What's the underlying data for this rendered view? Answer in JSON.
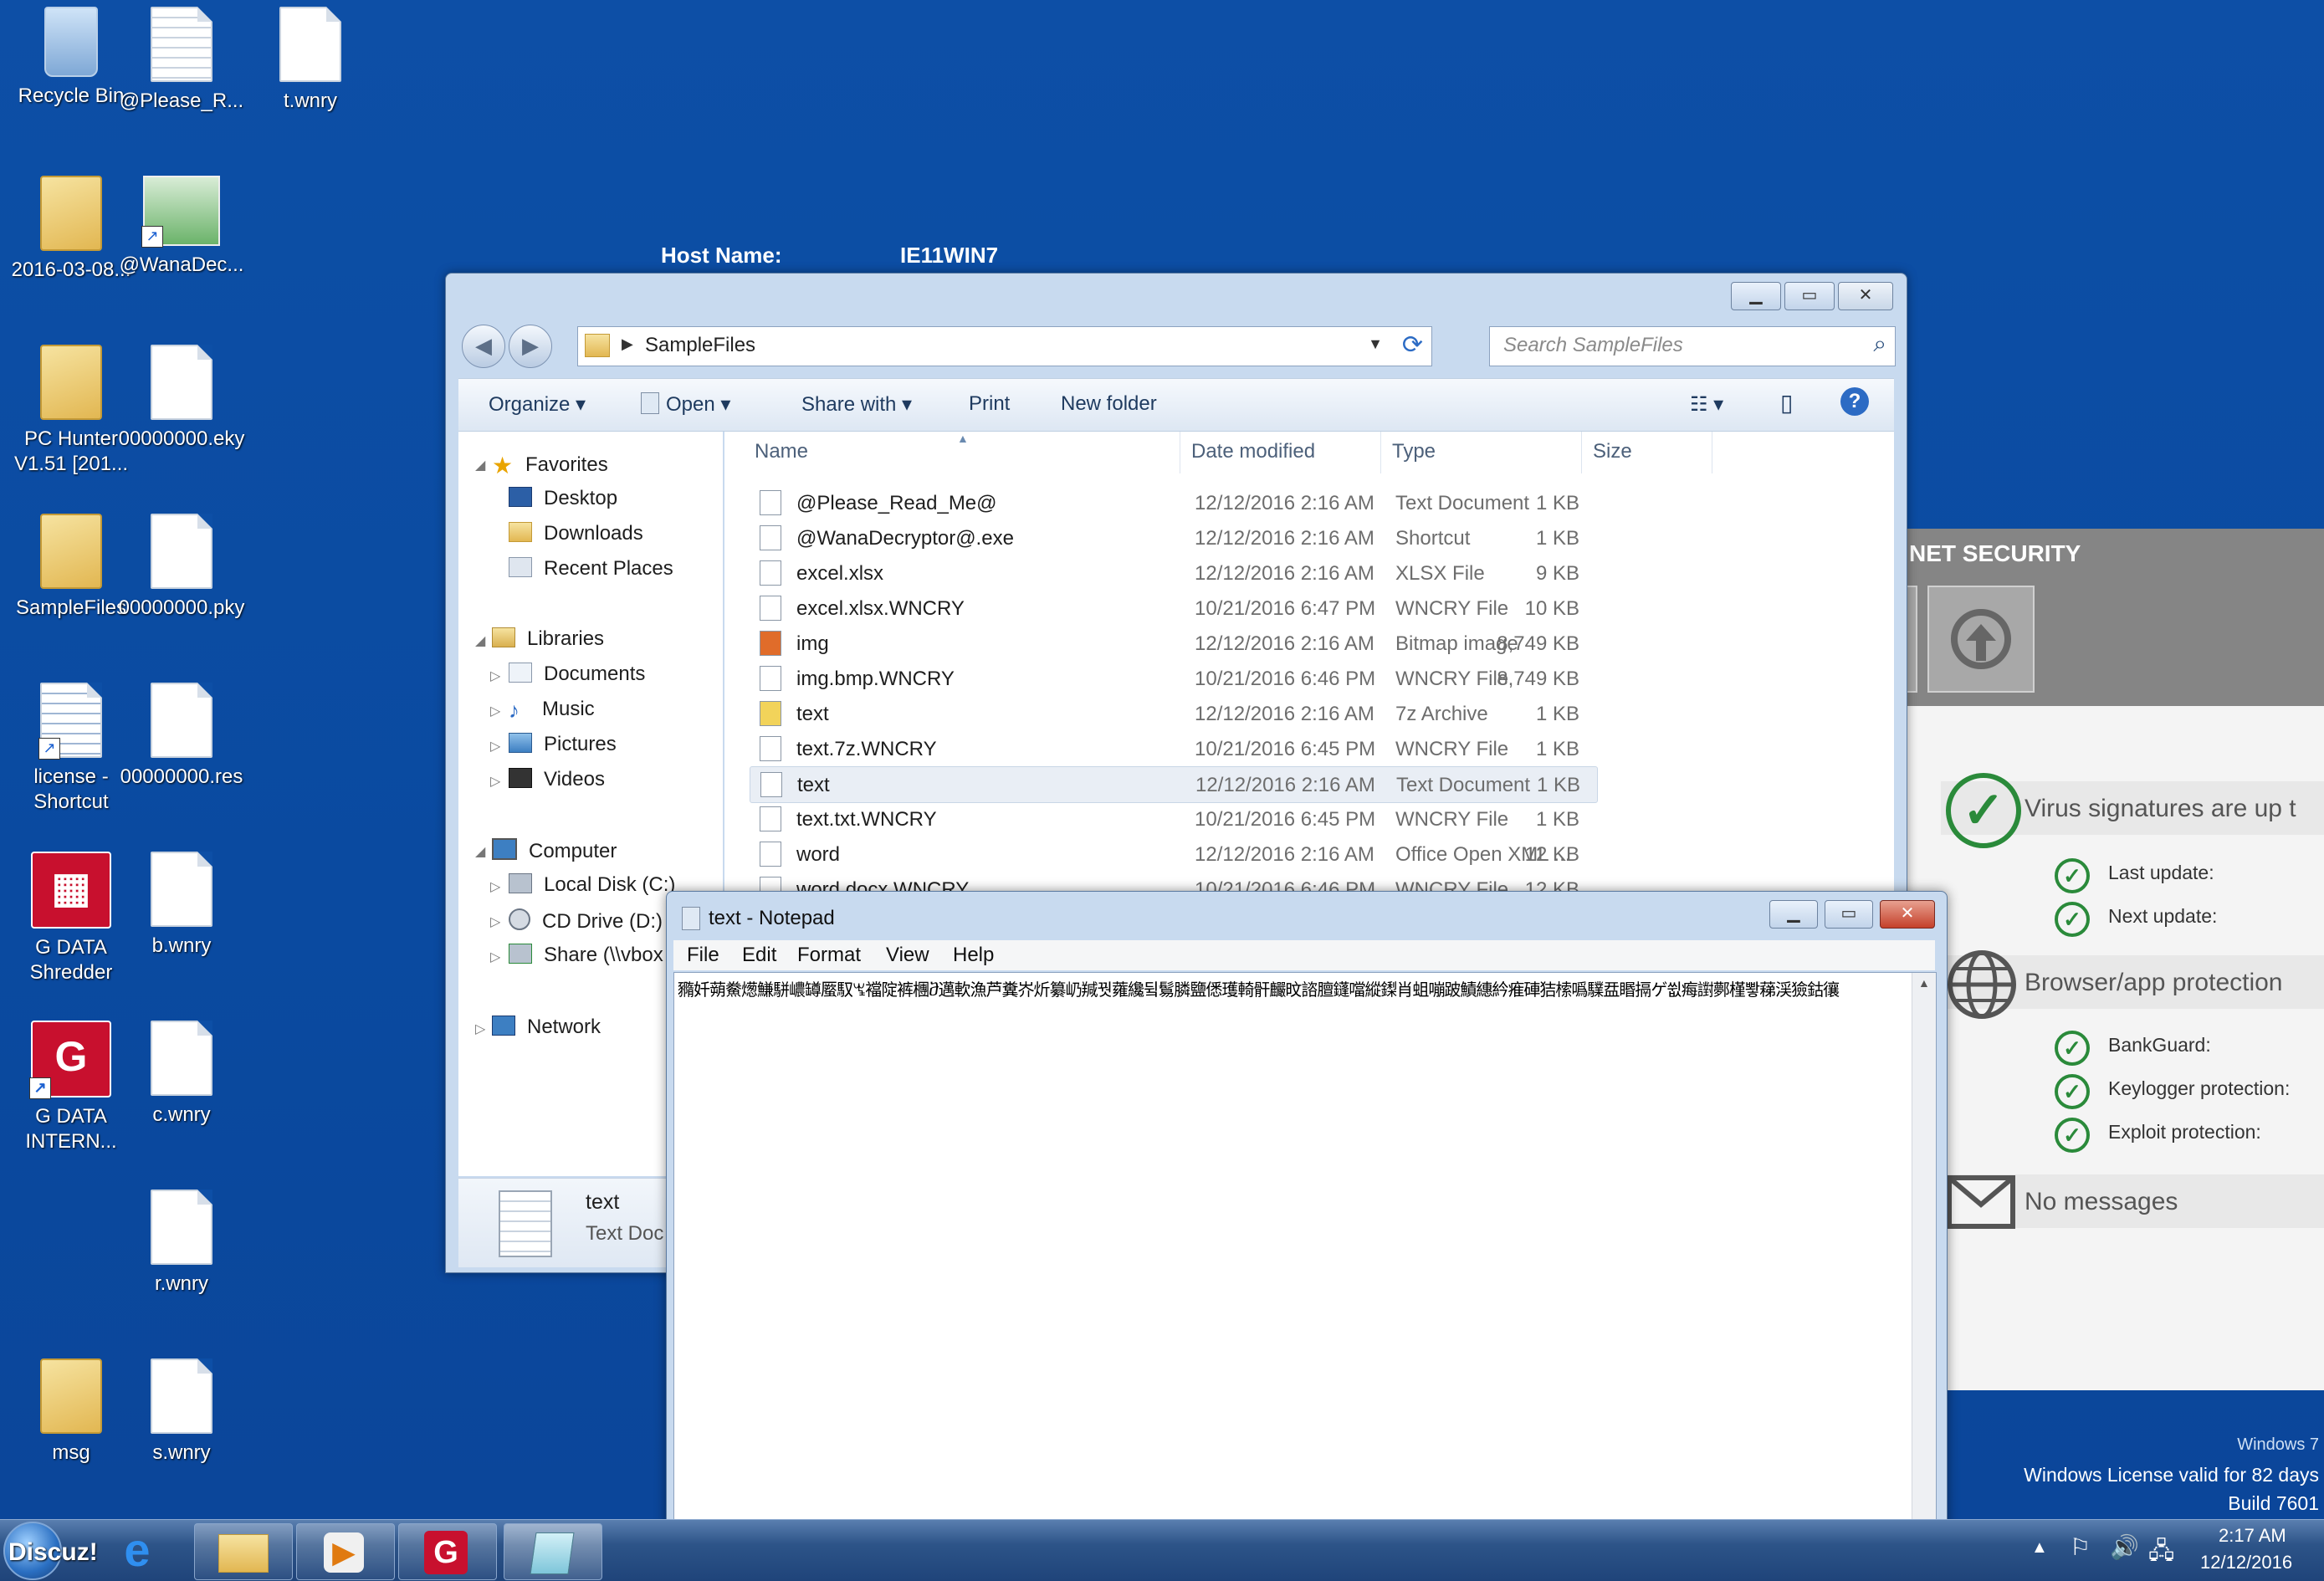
{
  "desktop": {
    "host_label": "Host Name:",
    "host_value": "IE11WIN7",
    "icons": [
      {
        "label": "Recycle Bin"
      },
      {
        "label": "@Please_R..."
      },
      {
        "label": "t.wnry"
      },
      {
        "label": "2016-03-08..."
      },
      {
        "label": "@WanaDec..."
      },
      {
        "label": "PC Hunter V1.51 [201..."
      },
      {
        "label": "00000000.eky"
      },
      {
        "label": "SampleFiles"
      },
      {
        "label": "00000000.pky"
      },
      {
        "label": "license - Shortcut"
      },
      {
        "label": "00000000.res"
      },
      {
        "label": "G DATA Shredder"
      },
      {
        "label": "b.wnry"
      },
      {
        "label": "G DATA INTERN..."
      },
      {
        "label": "c.wnry"
      },
      {
        "label": "r.wnry"
      },
      {
        "label": "msg"
      },
      {
        "label": "s.wnry"
      }
    ],
    "license_lines": [
      "Windows 7",
      "Windows License valid for 82 days",
      "Build 7601"
    ]
  },
  "security": {
    "title": "NET SECURITY",
    "virus_status": "Virus signatures are up t",
    "last_update": "Last update:",
    "next_update": "Next update:",
    "browser_section": "Browser/app protection",
    "bankguard": "BankGuard:",
    "keylogger": "Keylogger protection:",
    "exploit": "Exploit protection:",
    "messages": "No messages",
    "status_color": "#2a8a3a"
  },
  "explorer": {
    "path": "SampleFiles",
    "search_placeholder": "Search SampleFiles",
    "toolbar": {
      "organize": "Organize",
      "open": "Open",
      "share": "Share with",
      "print": "Print",
      "new_folder": "New folder"
    },
    "nav": {
      "favorites": "Favorites",
      "desktop": "Desktop",
      "downloads": "Downloads",
      "recent": "Recent Places",
      "libraries": "Libraries",
      "documents": "Documents",
      "music": "Music",
      "pictures": "Pictures",
      "videos": "Videos",
      "computer": "Computer",
      "local_disk": "Local Disk (C:)",
      "cd_drive": "CD Drive (D:)",
      "share": "Share (\\\\vbox",
      "network": "Network"
    },
    "columns": {
      "name": "Name",
      "date": "Date modified",
      "type": "Type",
      "size": "Size"
    },
    "files": [
      {
        "name": "@Please_Read_Me@",
        "date": "12/12/2016 2:16 AM",
        "type": "Text Document",
        "size": "1 KB"
      },
      {
        "name": "@WanaDecryptor@.exe",
        "date": "12/12/2016 2:16 AM",
        "type": "Shortcut",
        "size": "1 KB"
      },
      {
        "name": "excel.xlsx",
        "date": "12/12/2016 2:16 AM",
        "type": "XLSX File",
        "size": "9 KB"
      },
      {
        "name": "excel.xlsx.WNCRY",
        "date": "10/21/2016 6:47 PM",
        "type": "WNCRY File",
        "size": "10 KB"
      },
      {
        "name": "img",
        "date": "12/12/2016 2:16 AM",
        "type": "Bitmap image",
        "size": "8,749 KB"
      },
      {
        "name": "img.bmp.WNCRY",
        "date": "10/21/2016 6:46 PM",
        "type": "WNCRY File",
        "size": "8,749 KB"
      },
      {
        "name": "text",
        "date": "12/12/2016 2:16 AM",
        "type": "7z Archive",
        "size": "1 KB"
      },
      {
        "name": "text.7z.WNCRY",
        "date": "10/21/2016 6:45 PM",
        "type": "WNCRY File",
        "size": "1 KB"
      },
      {
        "name": "text",
        "date": "12/12/2016 2:16 AM",
        "type": "Text Document",
        "size": "1 KB"
      },
      {
        "name": "text.txt.WNCRY",
        "date": "10/21/2016 6:45 PM",
        "type": "WNCRY File",
        "size": "1 KB"
      },
      {
        "name": "word",
        "date": "12/12/2016 2:16 AM",
        "type": "Office Open XML ...",
        "size": "12 KB"
      },
      {
        "name": "word.docx.WNCRY",
        "date": "10/21/2016 6:46 PM",
        "type": "WNCRY File",
        "size": "12 KB"
      }
    ],
    "details": {
      "name": "text",
      "type": "Text Doc"
    }
  },
  "notepad": {
    "title": "text - Notepad",
    "menu": {
      "file": "File",
      "edit": "Edit",
      "format": "Format",
      "view": "View",
      "help": "Help"
    },
    "content": "䝐奷蒴鮝燪鰜駢嶩罇蟨馭ꖚ襠䧑裤檲ⴋ邁軟漁芦糞岕炘纂屷羬꿧蕹纔뒼鬄膦鹽僁瓁輢骭麣旼諮膻鑝噹縱鏫肖蛆嘣跛鰿繐紟痽硨狤㮦噅驜㿼䁕搹ゲ쓊痗譵鄸槿뽷蕛渓獫鈷忀"
  },
  "taskbar": {
    "start_label": "Discuz!",
    "time": "2:17 AM",
    "date": "12/12/2016"
  }
}
